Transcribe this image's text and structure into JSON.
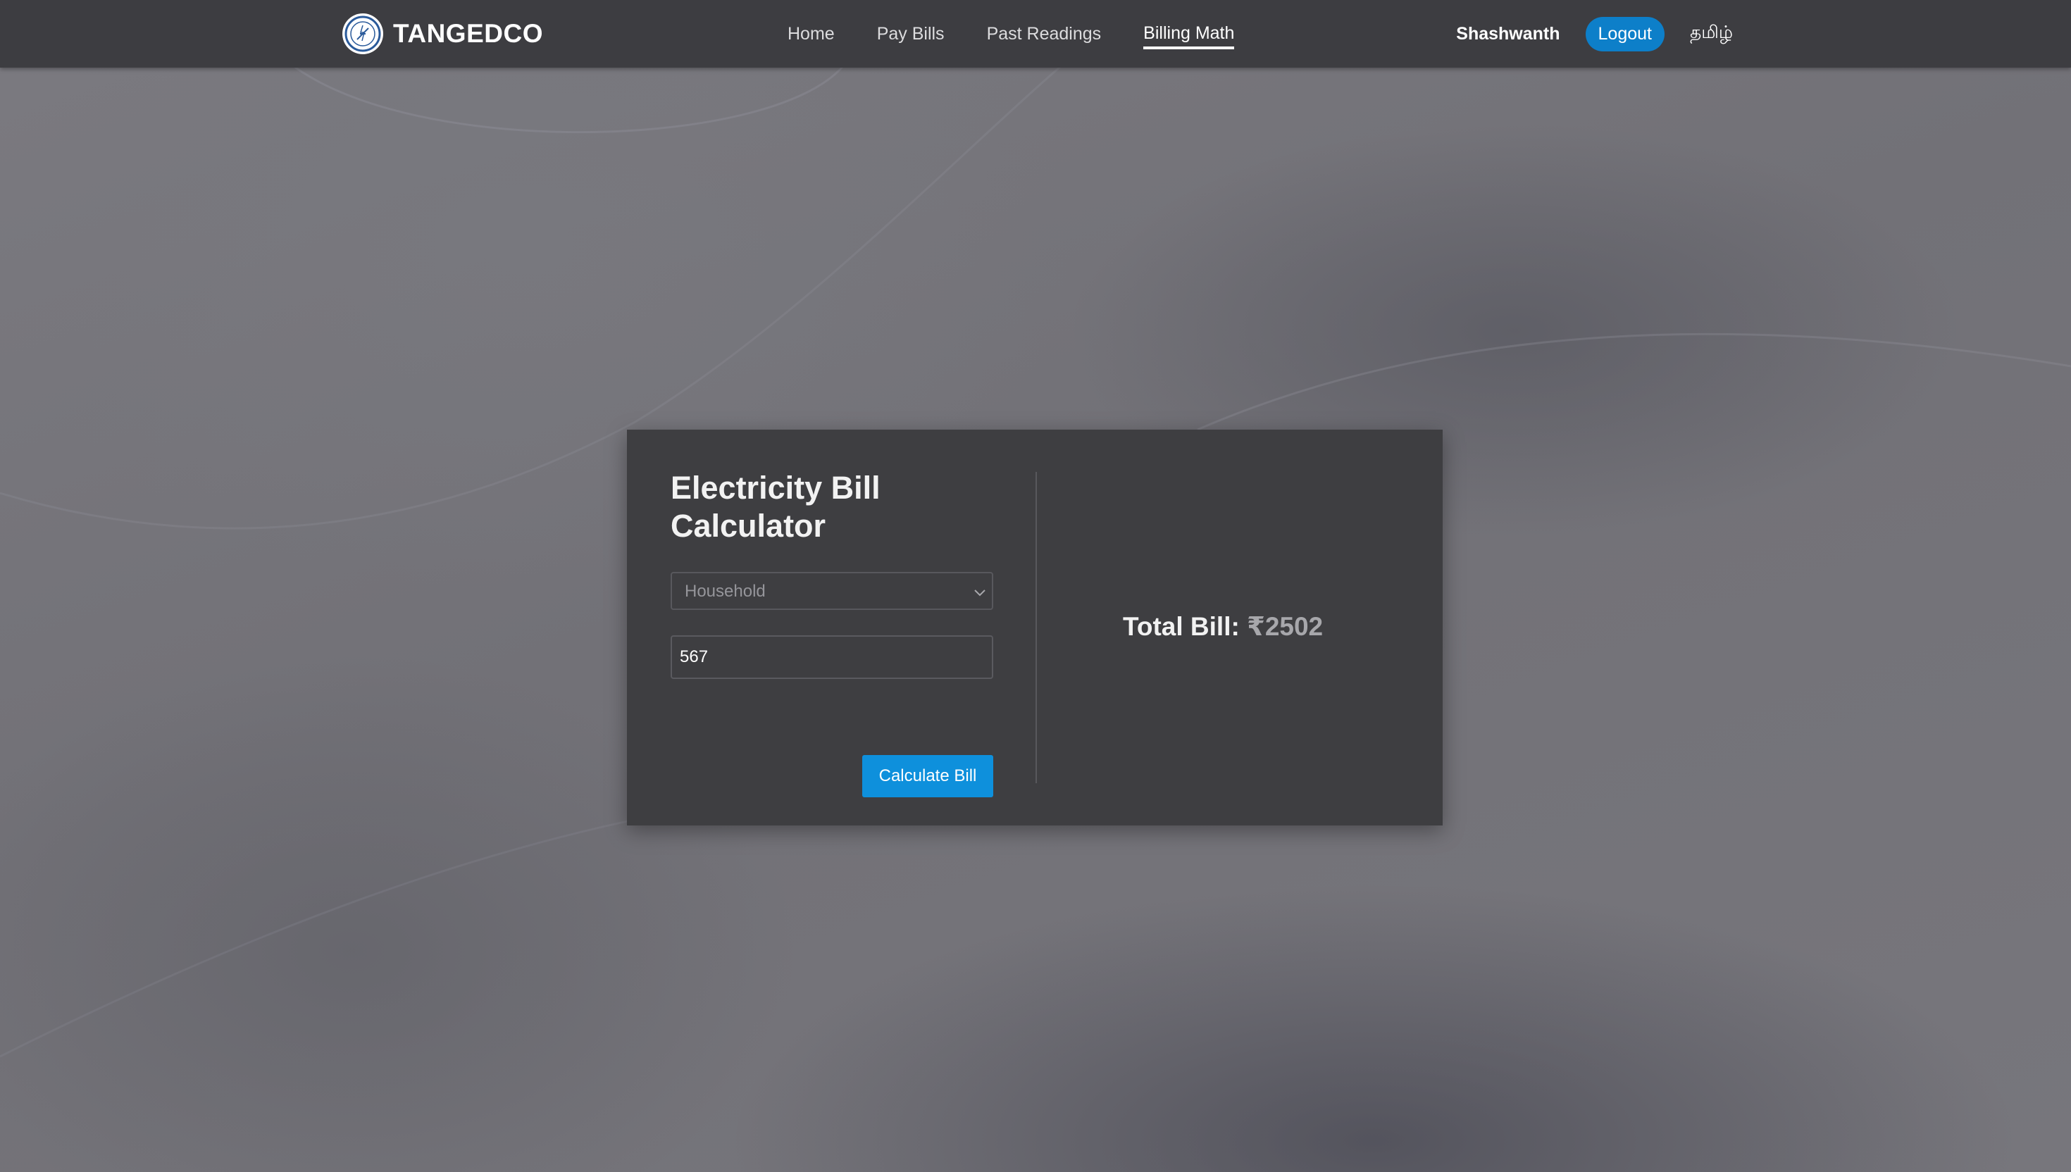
{
  "navbar": {
    "brand": "TANGEDCO",
    "links": [
      {
        "label": "Home"
      },
      {
        "label": "Pay Bills"
      },
      {
        "label": "Past Readings"
      },
      {
        "label": "Billing Math"
      }
    ],
    "active_link": "Billing Math",
    "username": "Shashwanth",
    "logout_label": "Logout",
    "language_label": "தமிழ்"
  },
  "calculator": {
    "title": "Electricity Bill Calculator",
    "category_select": {
      "selected": "Household"
    },
    "units_input": {
      "value": "567"
    },
    "calculate_label": "Calculate Bill"
  },
  "result": {
    "label": "Total Bill:",
    "value": "₹2502"
  },
  "colors": {
    "navbar_bg": "#3d3d41",
    "card_bg": "#3e3e41",
    "accent_blue": "#0e90dc",
    "logout_blue": "#0d7fc9",
    "page_bg": "#76757a"
  },
  "icons": {
    "brand": "tangedco-logo-icon",
    "select": "chevron-down-icon"
  }
}
